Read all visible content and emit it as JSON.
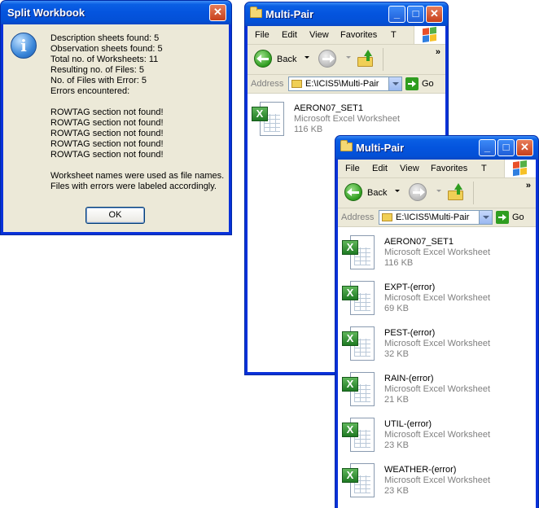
{
  "dialog": {
    "title": "Split Workbook",
    "lines": [
      "Description sheets found: 5",
      "Observation sheets found: 5",
      "Total no. of Worksheets: 11",
      "Resulting no. of Files: 5",
      "No. of Files with Error: 5",
      "Errors encountered:",
      "",
      "ROWTAG section not found!",
      "ROWTAG section not found!",
      "ROWTAG section not found!",
      "ROWTAG section not found!",
      "ROWTAG section not found!",
      "",
      "Worksheet names were used as file names.",
      "Files with errors were labeled accordingly."
    ],
    "ok_label": "OK",
    "close_glyph": "✕",
    "icon_glyph": "i"
  },
  "explorer_back": {
    "title": "Multi-Pair",
    "menu": [
      "File",
      "Edit",
      "View",
      "Favorites",
      "T"
    ],
    "back_label": "Back",
    "address_label": "Address",
    "address_value": "E:\\ICIS5\\Multi-Pair",
    "go_label": "Go",
    "files": [
      {
        "name": "AERON07_SET1",
        "type": "Microsoft Excel Worksheet",
        "size": "116 KB"
      }
    ]
  },
  "explorer_front": {
    "title": "Multi-Pair",
    "menu": [
      "File",
      "Edit",
      "View",
      "Favorites",
      "T"
    ],
    "back_label": "Back",
    "address_label": "Address",
    "address_value": "E:\\ICIS5\\Multi-Pair",
    "go_label": "Go",
    "files": [
      {
        "name": "AERON07_SET1",
        "type": "Microsoft Excel Worksheet",
        "size": "116 KB"
      },
      {
        "name": "EXPT-(error)",
        "type": "Microsoft Excel Worksheet",
        "size": "69 KB"
      },
      {
        "name": "PEST-(error)",
        "type": "Microsoft Excel Worksheet",
        "size": "32 KB"
      },
      {
        "name": "RAIN-(error)",
        "type": "Microsoft Excel Worksheet",
        "size": "21 KB"
      },
      {
        "name": "UTIL-(error)",
        "type": "Microsoft Excel Worksheet",
        "size": "23 KB"
      },
      {
        "name": "WEATHER-(error)",
        "type": "Microsoft Excel Worksheet",
        "size": "23 KB"
      }
    ]
  },
  "window_buttons": {
    "minimize": "_",
    "maximize": "□",
    "close": "✕"
  },
  "toolbar_overflow": "»",
  "excel_badge": "X"
}
